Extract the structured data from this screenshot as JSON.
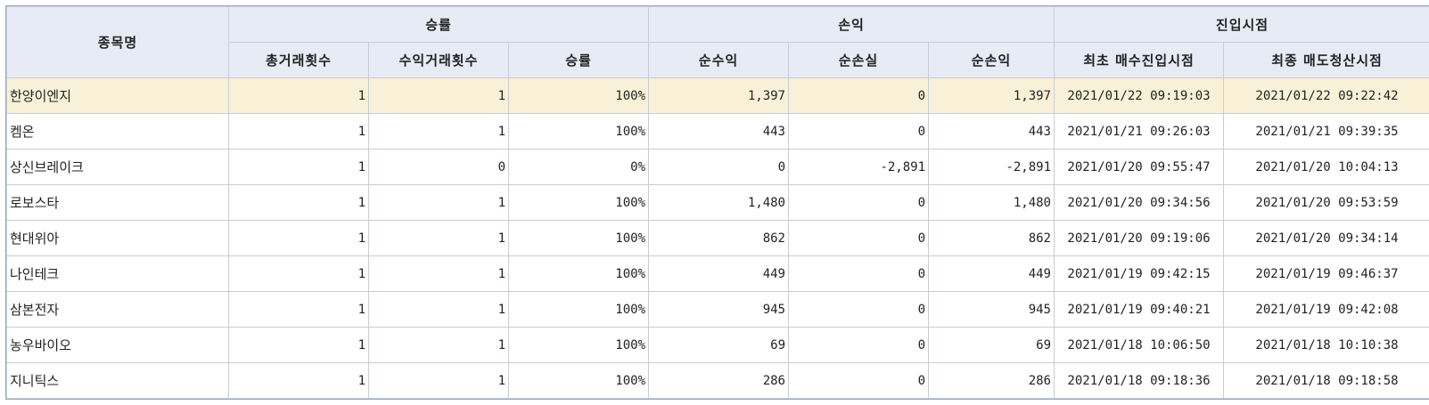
{
  "headers": {
    "name": "종목명",
    "group_winrate": "승률",
    "group_pnl": "손익",
    "group_entry": "진입시점",
    "total_trades": "총거래횟수",
    "profit_trades": "수익거래횟수",
    "winrate": "승률",
    "net_profit": "순수익",
    "net_loss": "순손실",
    "net_pnl": "순손익",
    "first_buy": "최초 매수진입시점",
    "last_sell": "최종 매도청산시점"
  },
  "rows": [
    {
      "name": "한양이엔지",
      "total": "1",
      "wins": "1",
      "rate": "100%",
      "profit": "1,397",
      "loss": "0",
      "pnl": "1,397",
      "first": "2021/01/22 09:19:03",
      "last": "2021/01/22 09:22:42"
    },
    {
      "name": "켐온",
      "total": "1",
      "wins": "1",
      "rate": "100%",
      "profit": "443",
      "loss": "0",
      "pnl": "443",
      "first": "2021/01/21 09:26:03",
      "last": "2021/01/21 09:39:35"
    },
    {
      "name": "상신브레이크",
      "total": "1",
      "wins": "0",
      "rate": "0%",
      "profit": "0",
      "loss": "-2,891",
      "pnl": "-2,891",
      "first": "2021/01/20 09:55:47",
      "last": "2021/01/20 10:04:13"
    },
    {
      "name": "로보스타",
      "total": "1",
      "wins": "1",
      "rate": "100%",
      "profit": "1,480",
      "loss": "0",
      "pnl": "1,480",
      "first": "2021/01/20 09:34:56",
      "last": "2021/01/20 09:53:59"
    },
    {
      "name": "현대위아",
      "total": "1",
      "wins": "1",
      "rate": "100%",
      "profit": "862",
      "loss": "0",
      "pnl": "862",
      "first": "2021/01/20 09:19:06",
      "last": "2021/01/20 09:34:14"
    },
    {
      "name": "나인테크",
      "total": "1",
      "wins": "1",
      "rate": "100%",
      "profit": "449",
      "loss": "0",
      "pnl": "449",
      "first": "2021/01/19 09:42:15",
      "last": "2021/01/19 09:46:37"
    },
    {
      "name": "삼본전자",
      "total": "1",
      "wins": "1",
      "rate": "100%",
      "profit": "945",
      "loss": "0",
      "pnl": "945",
      "first": "2021/01/19 09:40:21",
      "last": "2021/01/19 09:42:08"
    },
    {
      "name": "농우바이오",
      "total": "1",
      "wins": "1",
      "rate": "100%",
      "profit": "69",
      "loss": "0",
      "pnl": "69",
      "first": "2021/01/18 10:06:50",
      "last": "2021/01/18 10:10:38"
    },
    {
      "name": "지니틱스",
      "total": "1",
      "wins": "1",
      "rate": "100%",
      "profit": "286",
      "loss": "0",
      "pnl": "286",
      "first": "2021/01/18 09:18:36",
      "last": "2021/01/18 09:18:58"
    }
  ],
  "selected_row": 0,
  "colors": {
    "header_bg": "#e6ebf5",
    "selected_bg": "#f8f1d8",
    "grid": "#c8ccd6"
  }
}
